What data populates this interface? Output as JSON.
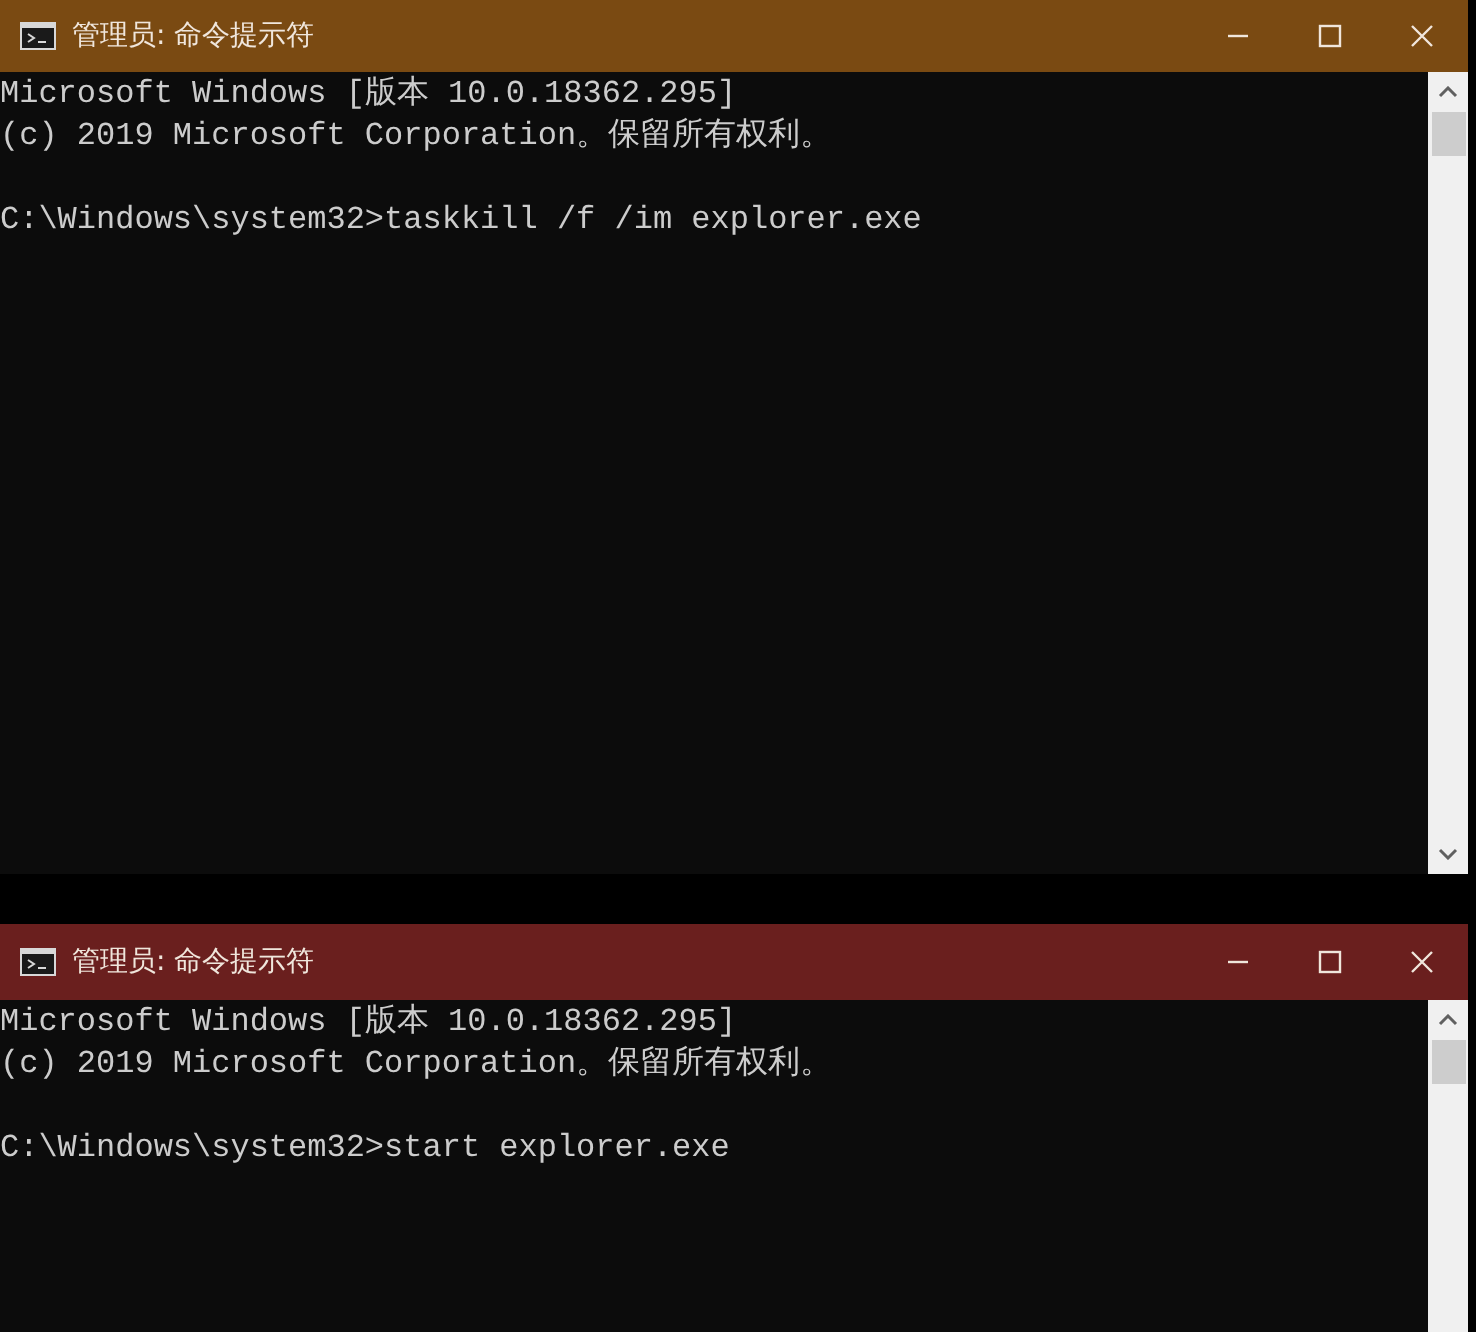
{
  "windows": [
    {
      "title": "管理员: 命令提示符",
      "color": "#7a4a12",
      "blocks": [
        [
          "Microsoft Windows [版本 10.0.18362.295]",
          "(c) 2019 Microsoft Corporation。保留所有权利。"
        ],
        [
          "C:\\Windows\\system32>taskkill /f /im explorer.exe"
        ]
      ]
    },
    {
      "title": "管理员: 命令提示符",
      "color": "#6a1f1e",
      "blocks": [
        [
          "Microsoft Windows [版本 10.0.18362.295]",
          "(c) 2019 Microsoft Corporation。保留所有权利。"
        ],
        [
          "C:\\Windows\\system32>start explorer.exe"
        ]
      ]
    }
  ]
}
